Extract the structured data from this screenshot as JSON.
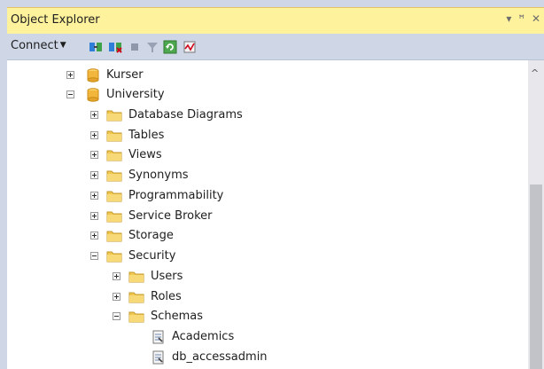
{
  "panel": {
    "title": "Object Explorer",
    "title_buttons": "▾ ⚲ ✕"
  },
  "toolbar": {
    "connect_label": "Connect",
    "icons": [
      "connect-icon",
      "disconnect-icon",
      "stop-icon",
      "filter-icon",
      "refresh-icon",
      "activity-monitor-icon"
    ]
  },
  "tree": {
    "nodes": [
      {
        "label": "Kurser",
        "icon": "database-icon",
        "expander": "plus"
      },
      {
        "label": "University",
        "icon": "database-icon",
        "expander": "minus"
      },
      {
        "label": "Database Diagrams",
        "icon": "folder-icon",
        "expander": "plus"
      },
      {
        "label": "Tables",
        "icon": "folder-icon",
        "expander": "plus"
      },
      {
        "label": "Views",
        "icon": "folder-icon",
        "expander": "plus"
      },
      {
        "label": "Synonyms",
        "icon": "folder-icon",
        "expander": "plus"
      },
      {
        "label": "Programmability",
        "icon": "folder-icon",
        "expander": "plus"
      },
      {
        "label": "Service Broker",
        "icon": "folder-icon",
        "expander": "plus"
      },
      {
        "label": "Storage",
        "icon": "folder-icon",
        "expander": "plus"
      },
      {
        "label": "Security",
        "icon": "folder-icon",
        "expander": "minus"
      },
      {
        "label": "Users",
        "icon": "folder-icon",
        "expander": "plus"
      },
      {
        "label": "Roles",
        "icon": "folder-icon",
        "expander": "plus"
      },
      {
        "label": "Schemas",
        "icon": "folder-icon",
        "expander": "minus"
      },
      {
        "label": "Academics",
        "icon": "schema-icon",
        "expander": "none"
      },
      {
        "label": "db_accessadmin",
        "icon": "schema-icon",
        "expander": "none"
      }
    ]
  },
  "colors": {
    "title_bg": "#fff29d",
    "toolbar_bg": "#cfd6e5",
    "folder": "#f0c850",
    "database": "#f2b63c"
  }
}
